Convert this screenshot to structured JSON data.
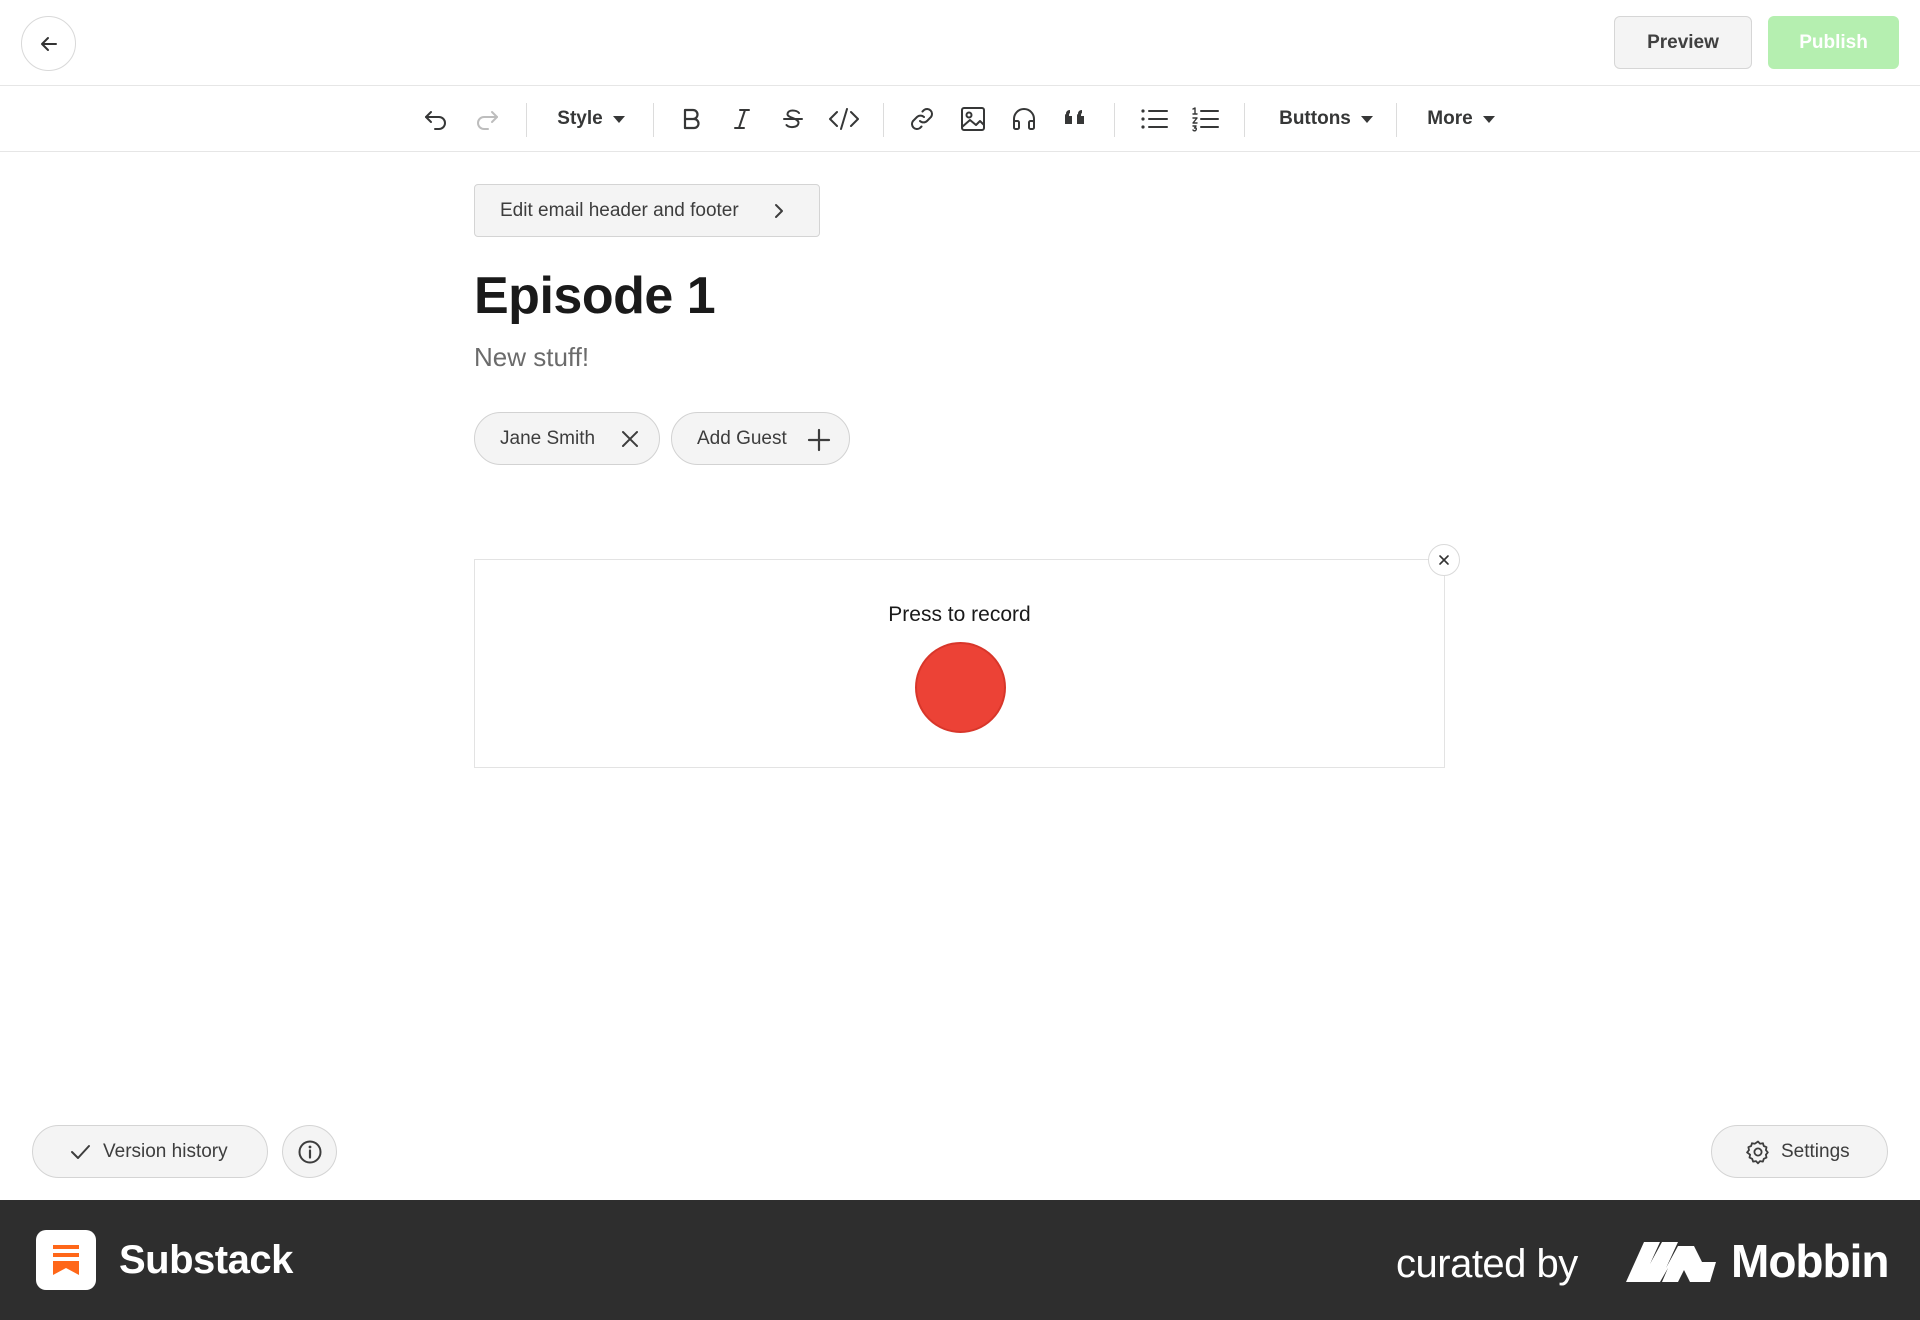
{
  "topbar": {
    "back_icon": "arrow-left-icon",
    "preview_label": "Preview",
    "publish_label": "Publish"
  },
  "toolbar": {
    "style_label": "Style",
    "buttons_label": "Buttons",
    "more_label": "More",
    "icons": [
      "undo-icon",
      "redo-icon",
      "bold-icon",
      "italic-icon",
      "strikethrough-icon",
      "code-icon",
      "link-icon",
      "image-icon",
      "audio-icon",
      "quote-icon",
      "bullet-list-icon",
      "numbered-list-icon"
    ]
  },
  "editor": {
    "edit_header_label": "Edit email header and footer",
    "title": "Episode 1",
    "subtitle": "New stuff!",
    "guests": [
      {
        "name": "Jane Smith"
      }
    ],
    "add_guest_label": "Add Guest"
  },
  "recorder": {
    "label": "Press to record",
    "record_color": "#ec4236"
  },
  "bottom": {
    "version_history_label": "Version history",
    "settings_label": "Settings"
  },
  "footer": {
    "app_name": "Substack",
    "curated_by": "curated by",
    "brand": "Mobbin",
    "app_accent": "#ff6719"
  },
  "colors": {
    "publish_bg": "#b5efb0",
    "background": "#ffffff",
    "footer_bg": "#2e2e2e"
  }
}
